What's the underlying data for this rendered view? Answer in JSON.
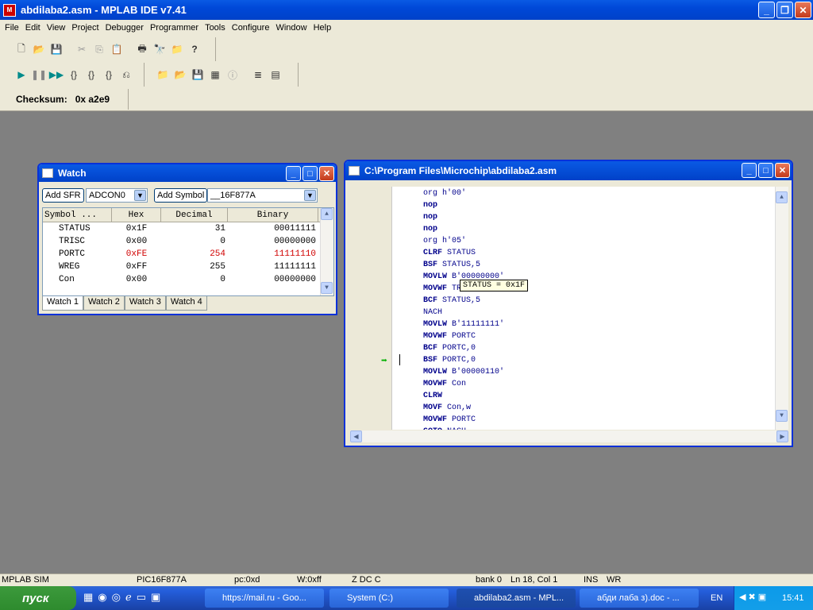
{
  "app": {
    "title": "abdilaba2.asm - MPLAB IDE v7.41"
  },
  "menu": [
    "File",
    "Edit",
    "View",
    "Project",
    "Debugger",
    "Programmer",
    "Tools",
    "Configure",
    "Window",
    "Help"
  ],
  "checksum": {
    "label": "Checksum:",
    "value": "0x a2e9"
  },
  "watch": {
    "title": "Watch",
    "add_sfr": "Add SFR",
    "sfr_select": "ADCON0",
    "add_symbol": "Add Symbol",
    "symbol_select": "__16F877A",
    "columns": [
      "Symbol ...",
      "Hex",
      "Decimal",
      "Binary"
    ],
    "rows": [
      {
        "symbol": "STATUS",
        "hex": "0x1F",
        "dec": "31",
        "bin": "00011111",
        "changed": false
      },
      {
        "symbol": "TRISC",
        "hex": "0x00",
        "dec": "0",
        "bin": "00000000",
        "changed": false
      },
      {
        "symbol": "PORTC",
        "hex": "0xFE",
        "dec": "254",
        "bin": "11111110",
        "changed": true
      },
      {
        "symbol": "WREG",
        "hex": "0xFF",
        "dec": "255",
        "bin": "11111111",
        "changed": false
      },
      {
        "symbol": "Con",
        "hex": "0x00",
        "dec": "0",
        "bin": "00000000",
        "changed": false
      }
    ],
    "tabs": [
      "Watch 1",
      "Watch 2",
      "Watch 3",
      "Watch 4"
    ]
  },
  "editor": {
    "title": "C:\\Program Files\\Microchip\\abdilaba2.asm",
    "lines": [
      {
        "op": "org",
        "arg": "h'00'",
        "style": "nm"
      },
      {
        "op": "nop",
        "arg": "",
        "style": "kw"
      },
      {
        "op": "nop",
        "arg": "",
        "style": "kw"
      },
      {
        "op": "nop",
        "arg": "",
        "style": "kw"
      },
      {
        "op": "org",
        "arg": "h'05'",
        "style": "nm"
      },
      {
        "op": "CLRF",
        "arg": "STATUS",
        "style": "kw"
      },
      {
        "op": "BSF",
        "arg": "STATUS,5",
        "style": "kw"
      },
      {
        "op": "MOVLW",
        "arg": "B'00000000'",
        "style": "kw"
      },
      {
        "op": "MOVWF",
        "arg": "TRISC",
        "style": "kw"
      },
      {
        "op": "BCF",
        "arg": "STATUS,5",
        "style": "kw"
      },
      {
        "op": "NACH",
        "arg": "",
        "style": "nm"
      },
      {
        "op": "MOVLW",
        "arg": "B'11111111'",
        "style": "kw"
      },
      {
        "op": "MOVWF",
        "arg": "PORTC",
        "style": "kw"
      },
      {
        "op": "BCF",
        "arg": "PORTC,0",
        "style": "kw"
      },
      {
        "op": "BSF",
        "arg": "PORTC,0",
        "style": "kw"
      },
      {
        "op": "MOVLW",
        "arg": "B'00000110'",
        "style": "kw"
      },
      {
        "op": "MOVWF",
        "arg": "Con",
        "style": "kw"
      },
      {
        "op": "CLRW",
        "arg": "",
        "style": "kw"
      },
      {
        "op": "MOVF",
        "arg": "Con,w",
        "style": "kw"
      },
      {
        "op": "MOVWF",
        "arg": "PORTC",
        "style": "kw"
      },
      {
        "op": "GOTO",
        "arg": "NACH",
        "style": "kw"
      }
    ],
    "tooltip": "STATUS = 0x1F"
  },
  "status": {
    "sim": "MPLAB SIM",
    "device": "PIC16F877A",
    "pc": "pc:0xd",
    "w": "W:0xff",
    "flags": "Z DC C",
    "bank": "bank 0",
    "pos": "Ln 18, Col 1",
    "ins": "INS",
    "wr": "WR"
  },
  "taskbar": {
    "start": "пуск",
    "tasks": [
      {
        "label": "https://mail.ru - Goo..."
      },
      {
        "label": "System (C:)"
      },
      {
        "label": "abdilaba2.asm - MPL..."
      },
      {
        "label": "абди лаба з).doc - ..."
      }
    ],
    "lang": "EN",
    "clock": "15:41"
  },
  "colors": {
    "titlebar": "#0a5ae4",
    "changed": "#d00000",
    "keyword": "#00008b",
    "desktop": "#808080"
  }
}
